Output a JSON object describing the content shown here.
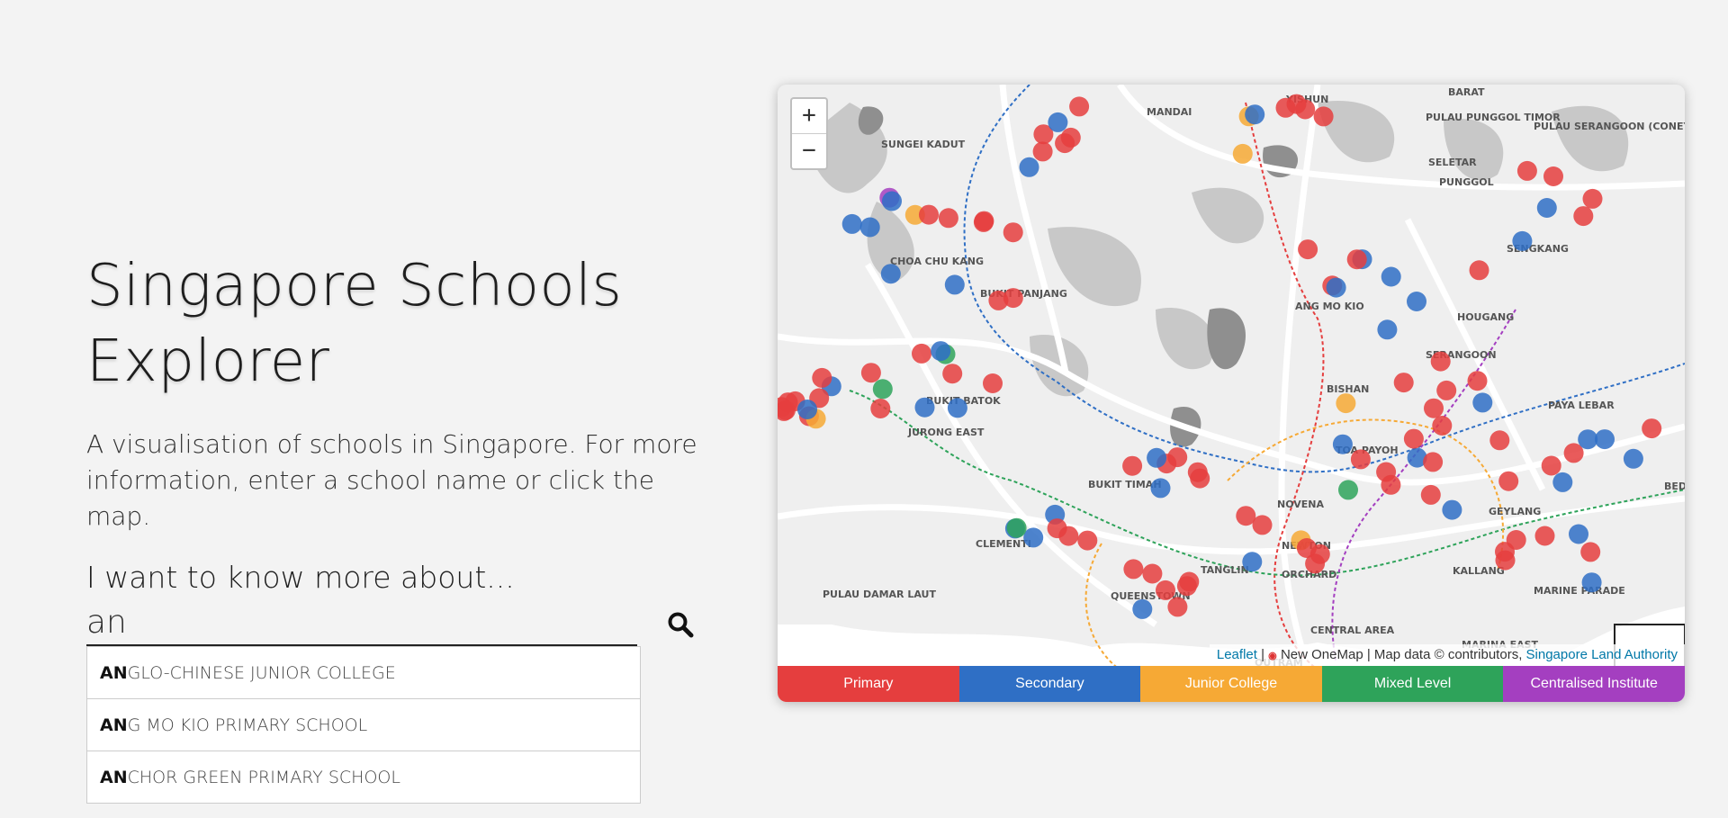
{
  "header": {
    "title_line1": "Singapore Schools",
    "title_line2": "Explorer",
    "description": "A visualisation of schools in Singapore. For more information, enter a school name or click the map."
  },
  "search": {
    "prompt": "I want to know more about...",
    "value": "an",
    "icon": "search-icon",
    "suggestions": [
      {
        "match": "AN",
        "rest": "GLO-CHINESE JUNIOR COLLEGE"
      },
      {
        "match": "AN",
        "rest": "G MO KIO PRIMARY SCHOOL"
      },
      {
        "match": "AN",
        "rest": "CHOR GREEN PRIMARY SCHOOL"
      }
    ]
  },
  "map": {
    "zoom_in": "+",
    "zoom_out": "−",
    "place_labels": [
      "MANDAI",
      "YISHUN",
      "SUNGEI KADUT",
      "SELETAR",
      "PUNGGOL",
      "PULAU PUNGGOL TIMOR",
      "PULAU SERANGOON (CONEY ISLAND)",
      "CHOA CHU KANG",
      "BUKIT PANJANG",
      "SENGKANG",
      "ANG MO KIO",
      "HOUGANG",
      "SERANGOON",
      "BISHAN",
      "PAYA LEBAR",
      "BUKIT BATOK",
      "JURONG EAST",
      "TOA PAYOH",
      "BUKIT TIMAH",
      "NOVENA",
      "GEYLANG",
      "NEWTON",
      "CLEMENTI",
      "KALLANG",
      "TANGLIN",
      "ORCHARD",
      "MARINE PARADE",
      "QUEENSTOWN",
      "PULAU DAMAR LAUT",
      "CENTRAL AREA",
      "MARINA EAST",
      "OUTRAM",
      "BEDOK",
      "BARAT"
    ],
    "attribution": {
      "leaflet": "Leaflet",
      "sep": "|",
      "onemap": "New OneMap | Map data © contributors,",
      "sla": "Singapore Land Authority"
    },
    "legend": [
      {
        "label": "Primary",
        "color": "#e53e3e"
      },
      {
        "label": "Secondary",
        "color": "#2f6fc5"
      },
      {
        "label": "Junior College",
        "color": "#f6a935"
      },
      {
        "label": "Mixed Level",
        "color": "#2ea35a"
      },
      {
        "label": "Centralised Institute",
        "color": "#a43fc0"
      }
    ]
  }
}
